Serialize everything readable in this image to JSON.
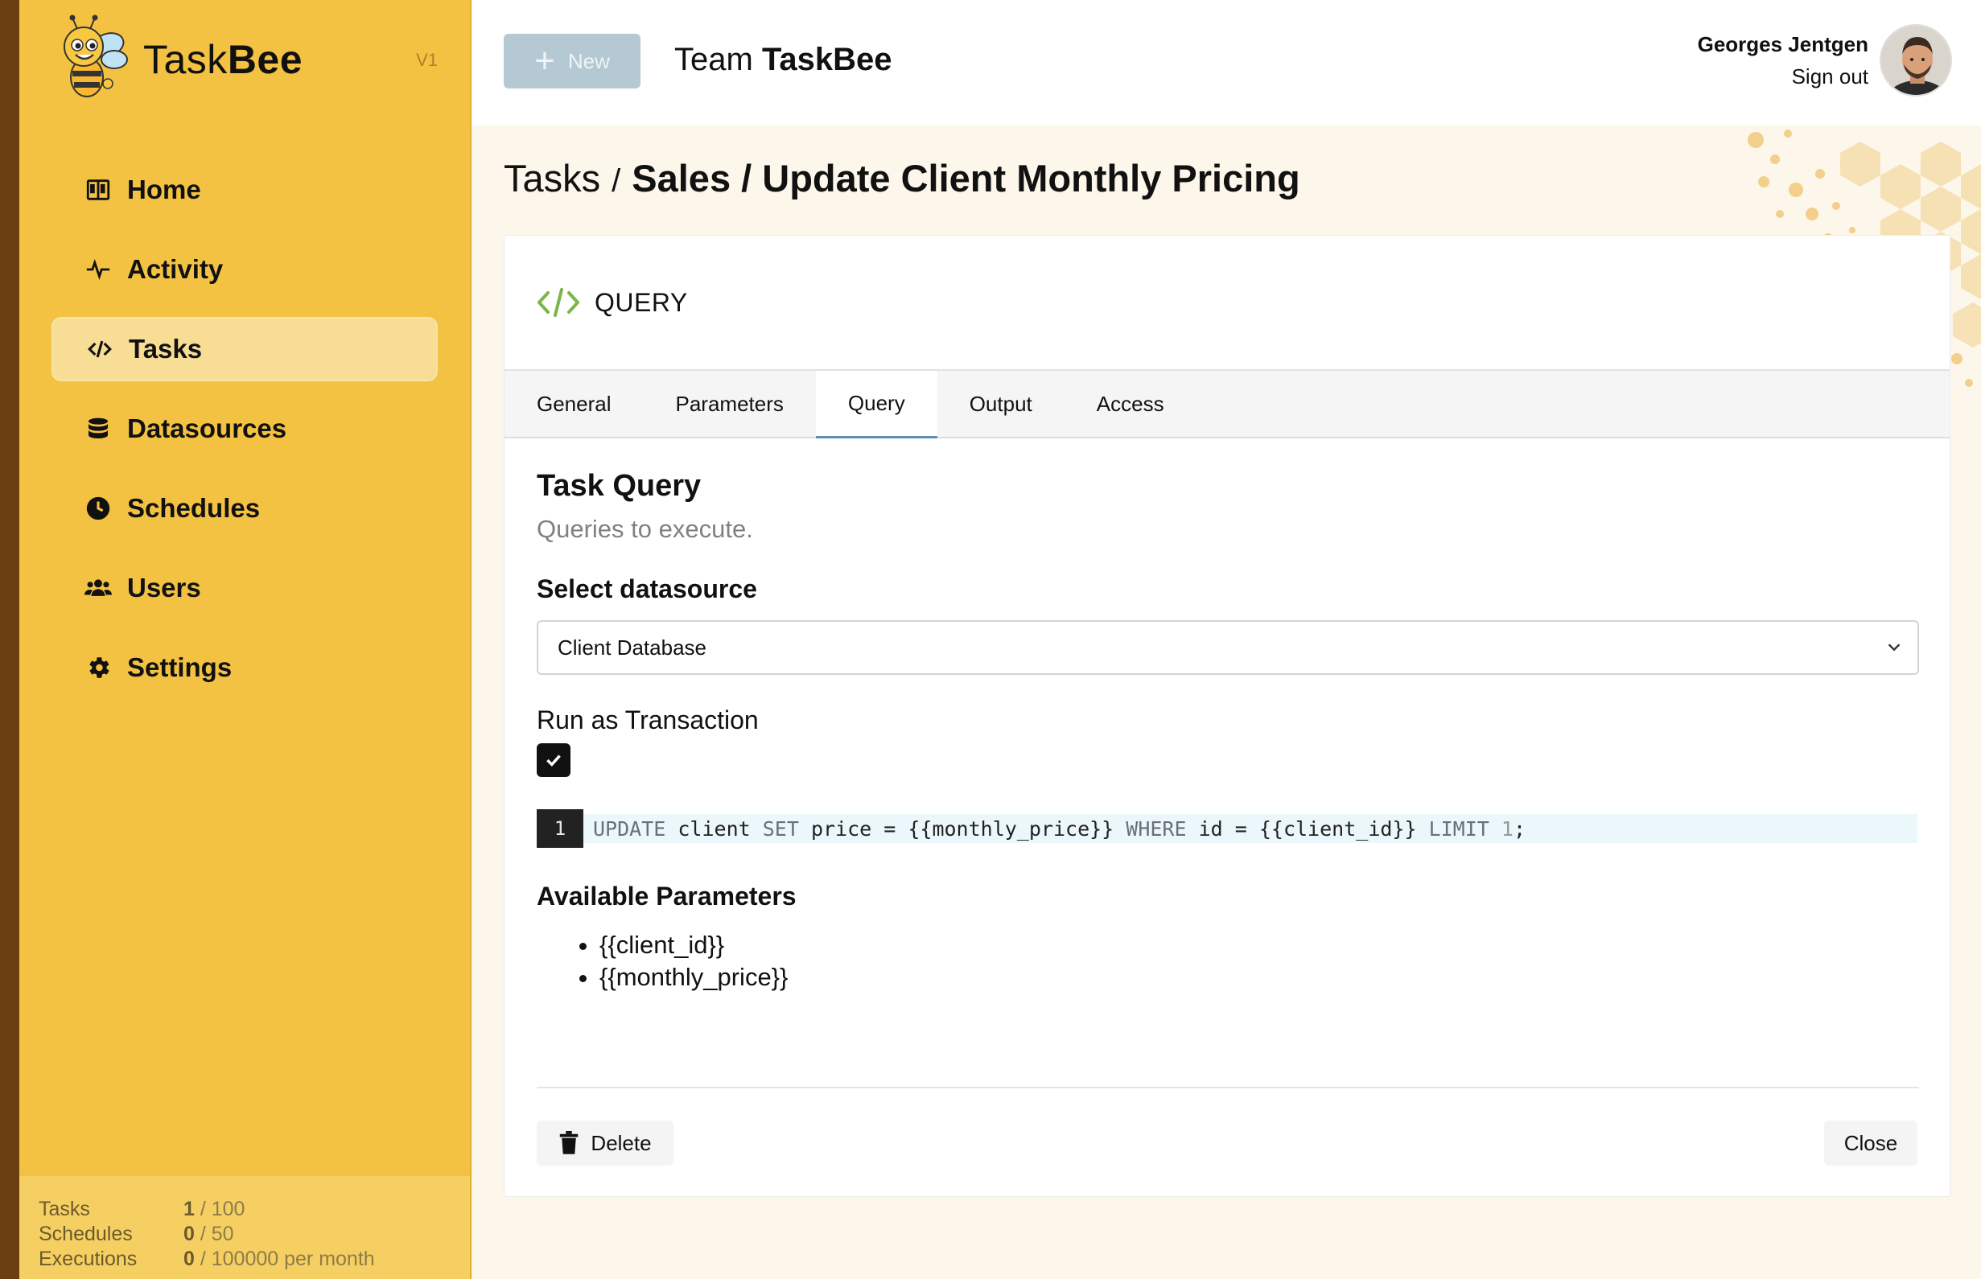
{
  "app": {
    "name_light": "Task",
    "name_bold": "Bee",
    "version": "V1"
  },
  "sidebar": {
    "items": [
      {
        "label": "Home",
        "icon": "building-icon"
      },
      {
        "label": "Activity",
        "icon": "pulse-icon"
      },
      {
        "label": "Tasks",
        "icon": "code-icon",
        "active": true
      },
      {
        "label": "Datasources",
        "icon": "database-icon"
      },
      {
        "label": "Schedules",
        "icon": "clock-icon"
      },
      {
        "label": "Users",
        "icon": "users-icon"
      },
      {
        "label": "Settings",
        "icon": "gear-icon"
      }
    ],
    "usage": [
      {
        "label": "Tasks",
        "used": "1",
        "limit": " / 100"
      },
      {
        "label": "Schedules",
        "used": "0",
        "limit": " / 50"
      },
      {
        "label": "Executions",
        "used": "0",
        "limit": " / 100000 per month"
      }
    ]
  },
  "topbar": {
    "new_label": "New",
    "team_prefix": "Team ",
    "team_name": "TaskBee",
    "user_name": "Georges Jentgen",
    "signout_label": "Sign out"
  },
  "breadcrumb": {
    "root": "Tasks",
    "separator": "/",
    "current": "Sales / Update Client Monthly Pricing"
  },
  "card": {
    "header_title": "QUERY",
    "tabs": [
      "General",
      "Parameters",
      "Query",
      "Output",
      "Access"
    ],
    "active_tab": "Query",
    "section_title": "Task Query",
    "section_subtitle": "Queries to execute.",
    "datasource_label": "Select datasource",
    "datasource_value": "Client Database",
    "transaction_label": "Run as Transaction",
    "transaction_checked": true,
    "editor": {
      "line_number": "1",
      "tokens": [
        {
          "t": "UPDATE",
          "c": "kw"
        },
        {
          "t": " client ",
          "c": ""
        },
        {
          "t": "SET",
          "c": "kw"
        },
        {
          "t": " price = {{monthly_price}} ",
          "c": ""
        },
        {
          "t": "WHERE",
          "c": "kw"
        },
        {
          "t": " id = {{client_id}} ",
          "c": ""
        },
        {
          "t": "LIMIT",
          "c": "kw"
        },
        {
          "t": " ",
          "c": ""
        },
        {
          "t": "1",
          "c": "num"
        },
        {
          "t": ";",
          "c": ""
        }
      ]
    },
    "params_title": "Available Parameters",
    "params": [
      "{{client_id}}",
      "{{monthly_price}}"
    ],
    "delete_label": "Delete",
    "close_label": "Close"
  },
  "colors": {
    "sidebar_bg": "#f4c242",
    "active_nav": "#f8dd95",
    "accent_green": "#7ab648",
    "tab_underline": "#5b8fb9"
  }
}
